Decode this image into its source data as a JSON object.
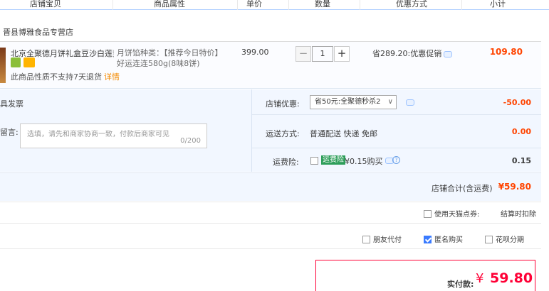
{
  "header": {
    "col_shop_item": "店铺宝贝",
    "col_props": "商品属性",
    "col_price": "单价",
    "col_qty": "数量",
    "col_discount": "优惠方式",
    "col_subtotal": "小计"
  },
  "shop": {
    "name": "晋县博雅食品专营店"
  },
  "item": {
    "title": "北京全聚德月饼礼盒豆沙白莲黄...",
    "note": "此商品性质不支持7天退货",
    "detail_link": "详情",
    "props": "月饼馅种类：【推荐今日特价】好运连连580g(8味8饼)",
    "price": "399.00",
    "quantity": "1",
    "promo": "省289.20:优惠促销",
    "subtotal": "109.80"
  },
  "extras": {
    "invoice_label": "具发票",
    "message_label": "留言:",
    "message_placeholder": "选填，请先和商家协商一致，付款后商家可见",
    "message_count": "0/200",
    "coupon_label": "店铺优惠:",
    "coupon_value": "省50元:全聚德秒杀2",
    "coupon_amount": "-50.00",
    "shipping_label": "运送方式:",
    "shipping_value": "普通配送 快递 免邮",
    "shipping_amount": "0.00",
    "insurance_label": "运费险:",
    "insurance_tag": "运费险",
    "insurance_price": "¥0.15购买",
    "insurance_amount": "0.15"
  },
  "shop_total": {
    "label": "店铺合计(含运费)",
    "value": "¥59.80"
  },
  "options": {
    "tmall_points": "使用天猫点券:",
    "deduct": "结算时扣除",
    "friend_pay": "朋友代付",
    "anonymous": "匿名购买",
    "anonymous_checked": true,
    "huabei": "花呗分期"
  },
  "payment": {
    "label": "实付款:",
    "currency": "¥",
    "amount": "59.80"
  },
  "colors": {
    "accent_red": "#ff0036",
    "price_orange": "#ff4400",
    "header_border": "#b2d1ff",
    "section_bg": "#f2f7ff"
  }
}
